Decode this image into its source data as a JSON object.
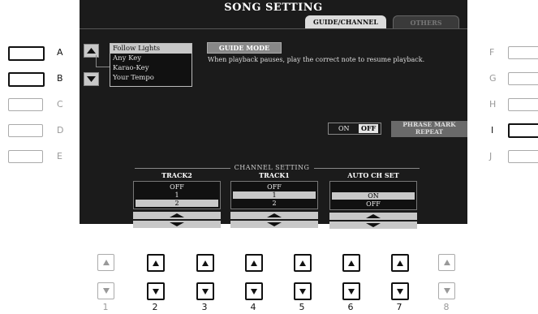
{
  "title": "SONG SETTING",
  "tabs": [
    {
      "label": "GUIDE/CHANNEL",
      "active": true
    },
    {
      "label": "OTHERS",
      "active": false
    }
  ],
  "guide_list": [
    "Follow Lights",
    "Any Key",
    "Karao-Key",
    "Your Tempo"
  ],
  "guide_mode": {
    "label": "GUIDE MODE",
    "description": "When playback pauses, play the correct note to resume playback."
  },
  "phrase_mark": {
    "on": "ON",
    "off": "OFF",
    "label_line1": "PHRASE MARK",
    "label_line2": "REPEAT"
  },
  "channel_setting": {
    "title": "CHANNEL SETTING",
    "columns": [
      {
        "header": "TRACK2",
        "options": [
          "OFF",
          "1",
          "2"
        ],
        "selected": 2
      },
      {
        "header": "TRACK1",
        "options": [
          "OFF",
          "1",
          "2"
        ],
        "selected": 1
      },
      {
        "header": "AUTO CH SET",
        "options": [
          "ON",
          "OFF"
        ],
        "selected": 0
      }
    ]
  },
  "left_buttons": [
    {
      "label": "A",
      "active": true
    },
    {
      "label": "B",
      "active": true
    },
    {
      "label": "C",
      "active": false
    },
    {
      "label": "D",
      "active": false
    },
    {
      "label": "E",
      "active": false
    }
  ],
  "right_buttons": [
    {
      "label": "F",
      "active": false
    },
    {
      "label": "G",
      "active": false
    },
    {
      "label": "H",
      "active": false
    },
    {
      "label": "I",
      "active": true
    },
    {
      "label": "J",
      "active": false
    }
  ],
  "bottom_buttons": [
    {
      "label": "1",
      "active": false
    },
    {
      "label": "2",
      "active": true
    },
    {
      "label": "3",
      "active": true
    },
    {
      "label": "4",
      "active": true
    },
    {
      "label": "5",
      "active": true
    },
    {
      "label": "6",
      "active": true
    },
    {
      "label": "7",
      "active": true
    },
    {
      "label": "8",
      "active": false
    }
  ],
  "icons": {
    "up": "arrow-up-icon",
    "down": "arrow-down-icon"
  },
  "colors": {
    "screen_bg": "#1b1b1b",
    "highlight": "#c8c8c8",
    "active_border": "#111111",
    "inactive_border": "#aaaaaa"
  }
}
